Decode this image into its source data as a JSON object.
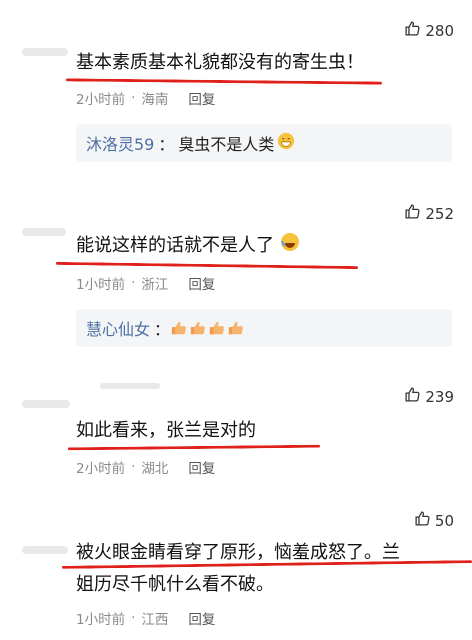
{
  "comments": [
    {
      "likes": "280",
      "text": "基本素质基本礼貌都没有的寄生虫！",
      "time": "2小时前",
      "location": "海南",
      "reply_label": "回复",
      "reply": {
        "name": "沐洛灵59",
        "text": "臭虫不是人类",
        "emoji": "grinning-sweat-emoji"
      }
    },
    {
      "likes": "252",
      "text": "能说这样的话就不是人了",
      "emoji": "laughing-tears-emoji",
      "time": "1小时前",
      "location": "浙江",
      "reply_label": "回复",
      "reply": {
        "name": "慧心仙女",
        "text": "",
        "emoji": "thumbs-up-emoji x4"
      }
    },
    {
      "likes": "239",
      "text": "如此看来，张兰是对的",
      "time": "2小时前",
      "location": "湖北",
      "reply_label": "回复"
    },
    {
      "likes": "50",
      "text_line1": "被火眼金睛看穿了原形，恼羞成怒了。兰",
      "text_line2": "姐历尽千帆什么看不破。",
      "time": "1小时前",
      "location": "江西",
      "reply_label": "回复"
    }
  ],
  "colors": {
    "underline": "#e0201b",
    "reply_name": "#4d6fa5",
    "meta": "#8a8a8a"
  }
}
